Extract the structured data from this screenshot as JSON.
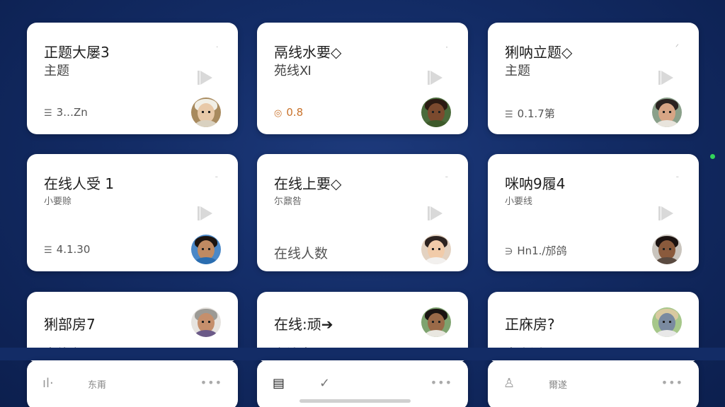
{
  "cards": [
    {
      "title": "正题大屡3",
      "subtitle": "主题",
      "corner": "ᐧ",
      "meta_icon": "☰",
      "meta": "3.‥Zn",
      "avatar": {
        "bg": "#a88a5e",
        "face": "#e8c9a8",
        "hair": "#f1efe6",
        "body": "#d9d1c0"
      }
    },
    {
      "title": "鬲线水要◇",
      "subtitle": "苑线Ⅺ",
      "corner": "·",
      "meta_icon": "◎",
      "meta": "0.8",
      "avatar": {
        "bg": "#4a6b3b",
        "face": "#7b4a2e",
        "hair": "#2b1a12",
        "body": "#3e5a2a"
      }
    },
    {
      "title": "猁呐立题◇",
      "subtitle": "主题",
      "corner": "ᐟ",
      "meta_icon": "☰",
      "meta": "0.1.7第",
      "avatar": {
        "bg": "#8aa08a",
        "face": "#d7a585",
        "hair": "#2a2220",
        "body": "#e8e4dc"
      }
    },
    {
      "title": "在线人受 1",
      "subtitle": "小要赊",
      "corner": "ᐨ",
      "meta_icon": "☰",
      "meta": "4.1.30",
      "avatar": {
        "bg": "#4b88c7",
        "face": "#c08a62",
        "hair": "#1c1410",
        "body": "#2a6db0"
      }
    },
    {
      "title": "在线上要◇",
      "subtitle": "尓鼐咎",
      "corner": "ᐨ",
      "meta_icon": "",
      "meta": "在线人数",
      "avatar": {
        "bg": "#e3d2c1",
        "face": "#f1cba9",
        "hair": "#2d2320",
        "body": "#f2f0ee"
      }
    },
    {
      "title": "咪呐9履4",
      "subtitle": "小要线",
      "corner": "ᐨ",
      "meta_icon": "∋",
      "meta": "Hn1.∕​​​邡鸽",
      "avatar": {
        "bg": "#c9c4bd",
        "face": "#8a5a3c",
        "hair": "#1b1210",
        "body": "#5a4a40"
      }
    },
    {
      "title": "猁部房7",
      "subtitle": "南线安",
      "avatar": {
        "bg": "#e6e3df",
        "face": "#c58f6c",
        "hair": "#9c9a95",
        "body": "#6b5a88"
      }
    },
    {
      "title": "在线:顽➔",
      "subtitle": "在流南",
      "avatar": {
        "bg": "#7ea36f",
        "face": "#9a6a48",
        "hair": "#1a1412",
        "body": "#e9e7e0"
      }
    },
    {
      "title": "正庥房?",
      "subtitle": "南山活",
      "avatar": {
        "bg": "#a6c78a",
        "face": "#7a8aa0",
        "hair": "#d9c9a0",
        "body": "#e8e8e8"
      }
    }
  ],
  "bottom": [
    {
      "icon": "ıl·",
      "label": "东甭",
      "dots": "•••"
    },
    {
      "icon": "▤",
      "icon2": "✓",
      "label": "",
      "dots": "•••"
    },
    {
      "icon": "♙",
      "label": "爾遂",
      "dots": "•••"
    }
  ]
}
